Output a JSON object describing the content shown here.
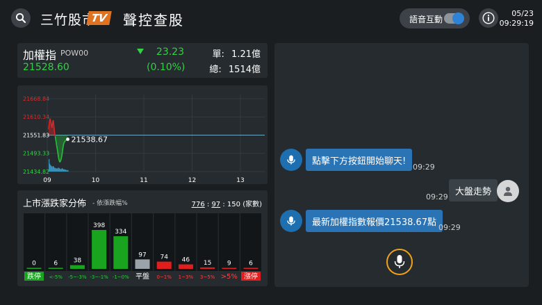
{
  "header": {
    "logo_text": "三竹股市",
    "logo_badge": "TV",
    "title": "聲控查股",
    "voice_label": "語音互動",
    "voice_toggle_on": true,
    "date": "05/23",
    "time": "09:29:19"
  },
  "index": {
    "name": "加權指",
    "code": "POW00",
    "value": "21528.60",
    "change": "23.23",
    "change_pct": "(0.10%)",
    "direction": "down",
    "single_label": "單:",
    "single_value": "1.21億",
    "total_label": "總:",
    "total_value": "1514億"
  },
  "chart_data": [
    {
      "type": "line",
      "y_ticks": [
        "21668.84",
        "21610.34",
        "21551.83",
        "21493.33",
        "21434.82"
      ],
      "y_tick_values": [
        21668.84,
        21610.34,
        21551.83,
        21493.33,
        21434.82
      ],
      "reference": 21551.83,
      "ylim": [
        21434.82,
        21668.84
      ],
      "x_ticks": [
        "09",
        "10",
        "11",
        "12",
        "13"
      ],
      "last_value_label": "21538.67",
      "x_minutes": [
        0,
        1,
        2,
        3,
        4,
        5,
        6,
        7,
        8,
        9,
        10,
        11,
        12,
        13,
        14,
        15,
        16,
        17,
        18,
        19,
        20,
        21,
        22,
        23,
        24,
        25,
        26,
        27,
        28,
        29
      ],
      "values": [
        21570,
        21590,
        21605,
        21598,
        21585,
        21575,
        21592,
        21600,
        21580,
        21560,
        21548,
        21535,
        21520,
        21508,
        21495,
        21480,
        21470,
        21465,
        21468,
        21475,
        21485,
        21500,
        21515,
        21525,
        21530,
        21533,
        21535,
        21536,
        21537,
        21538.67
      ],
      "volume": [
        95,
        60,
        50,
        45,
        40,
        35,
        42,
        38,
        30,
        28,
        26,
        24,
        25,
        22,
        30,
        28,
        24,
        20,
        18,
        22,
        26,
        20,
        16,
        18,
        14,
        15,
        12,
        10,
        12,
        8
      ],
      "colors": {
        "up": "#d92626",
        "down": "#27c13a",
        "reference": "#6fa8c0",
        "volume": "#3a8fb6"
      }
    },
    {
      "type": "bar",
      "title": "上市漲跌家分佈",
      "subtitle": "- 依漲跌幅%",
      "summary": {
        "up": "776",
        "flat": "97",
        "down": "150",
        "unit": "(家數)"
      },
      "categories": [
        "跌停",
        "<-5%",
        "-5~-3%",
        "-3~-1%",
        "-1~0%",
        "平盤",
        "0~1%",
        "1~3%",
        "3~5%",
        ">5%",
        "漲停"
      ],
      "values": [
        0,
        6,
        38,
        398,
        334,
        97,
        74,
        46,
        15,
        9,
        6
      ],
      "ylim": [
        0,
        398
      ],
      "bar_colors": [
        "#19a31f",
        "#19a31f",
        "#19a31f",
        "#19a31f",
        "#19a31f",
        "#9aa3aa",
        "#e01e1e",
        "#e01e1e",
        "#e01e1e",
        "#e01e1e",
        "#e01e1e"
      ],
      "label_bg": [
        "#19a31f",
        null,
        null,
        null,
        null,
        null,
        null,
        null,
        null,
        null,
        "#e01e1e"
      ],
      "label_color": [
        "#ffffff",
        "#2bcf3c",
        "#2bcf3c",
        "#2bcf3c",
        "#2bcf3c",
        "#ffffff",
        "#ff4040",
        "#ff4040",
        "#ff4040",
        "#ff4040",
        "#ffffff"
      ]
    }
  ],
  "chat": {
    "messages": [
      {
        "from": "bot",
        "text": "點擊下方按鈕開始聊天!",
        "time": "09:29"
      },
      {
        "from": "user",
        "text": "大盤走勢",
        "time": "09:29"
      },
      {
        "from": "bot",
        "text": "最新加權指數報價21538.67點",
        "time": "09:29"
      }
    ]
  },
  "icons": {
    "search": "search-icon",
    "info": "info-icon",
    "mic": "microphone-icon",
    "bot_avatar": "microphone-avatar-icon",
    "user_avatar": "user-avatar-icon"
  }
}
